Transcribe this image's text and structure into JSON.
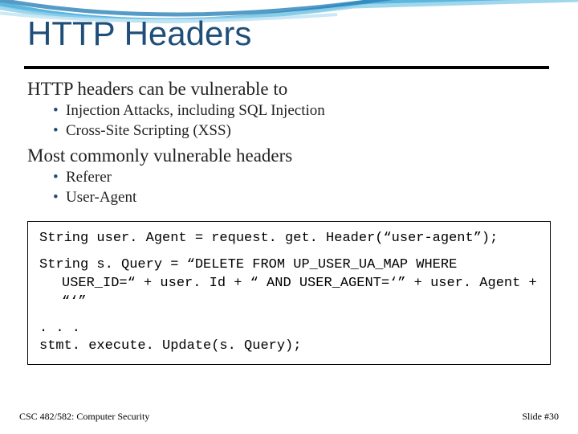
{
  "title": "HTTP Headers",
  "section1": {
    "heading": "HTTP headers can be vulnerable to",
    "items": [
      "Injection Attacks, including SQL Injection",
      "Cross-Site Scripting (XSS)"
    ]
  },
  "section2": {
    "heading": "Most commonly vulnerable headers",
    "items": [
      "Referer",
      "User-Agent"
    ]
  },
  "code": {
    "line1": "String user. Agent = request. get. Header(“user-agent”);",
    "line2a": "String s. Query = “DELETE FROM UP_USER_UA_MAP WHERE",
    "line2b": "USER_ID=“ + user. Id + “ AND USER_AGENT=‘” + user. Agent + “‘”",
    "line3a": ". . .",
    "line3b": "stmt. execute. Update(s. Query);"
  },
  "footer": {
    "left": "CSC 482/582: Computer Security",
    "right": "Slide #30"
  }
}
